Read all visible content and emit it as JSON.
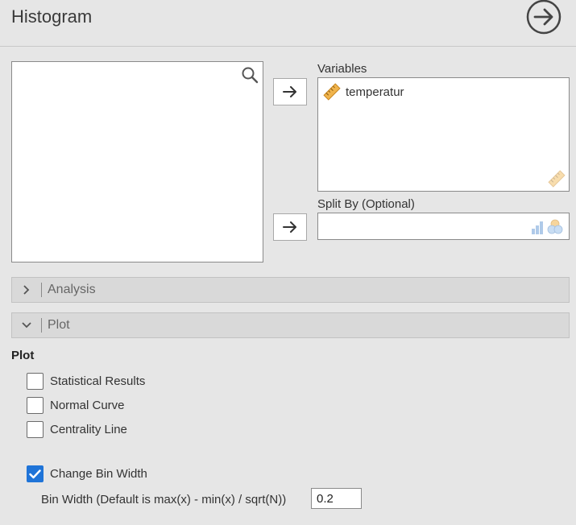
{
  "header": {
    "title": "Histogram",
    "run_icon": "arrow-circle-right-icon"
  },
  "source_box": {
    "search_icon": "search-icon"
  },
  "variables": {
    "label": "Variables",
    "items": [
      {
        "label": "temperatur",
        "icon": "ruler-icon"
      }
    ]
  },
  "split_by": {
    "label": "Split By (Optional)"
  },
  "sections": {
    "analysis": {
      "label": "Analysis",
      "expanded": false
    },
    "plot": {
      "label": "Plot",
      "expanded": true
    }
  },
  "plot_options": {
    "group_title": "Plot",
    "statistical_results": {
      "label": "Statistical Results",
      "checked": false
    },
    "normal_curve": {
      "label": "Normal Curve",
      "checked": false
    },
    "centrality_line": {
      "label": "Centrality Line",
      "checked": false
    },
    "change_bin_width": {
      "label": "Change Bin Width",
      "checked": true
    },
    "bin_width": {
      "label": "Bin Width (Default is max(x) - min(x) / sqrt(N))",
      "value": "0.2"
    }
  },
  "colors": {
    "accent": "#1f74d8",
    "background": "#e6e6e6",
    "ruler": "#e8a93a"
  }
}
